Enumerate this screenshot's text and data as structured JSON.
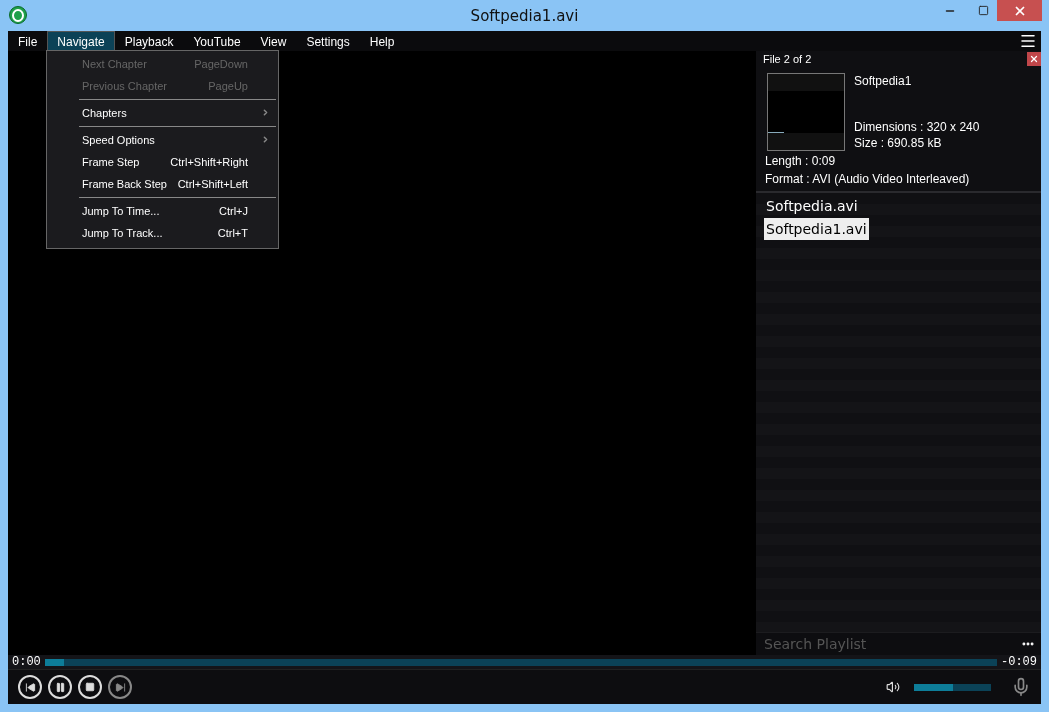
{
  "window": {
    "title": "Softpedia1.avi"
  },
  "menu_bar": [
    {
      "label": "File",
      "selected": false
    },
    {
      "label": "Navigate",
      "selected": true
    },
    {
      "label": "Playback",
      "selected": false
    },
    {
      "label": "YouTube",
      "selected": false
    },
    {
      "label": "View",
      "selected": false
    },
    {
      "label": "Settings",
      "selected": false
    },
    {
      "label": "Help",
      "selected": false
    }
  ],
  "navigate_menu": [
    {
      "kind": "item",
      "label": "Next Chapter",
      "shortcut": "PageDown",
      "disabled": true
    },
    {
      "kind": "item",
      "label": "Previous Chapter",
      "shortcut": "PageUp",
      "disabled": true
    },
    {
      "kind": "separator"
    },
    {
      "kind": "submenu",
      "label": "Chapters",
      "disabled": false
    },
    {
      "kind": "separator"
    },
    {
      "kind": "submenu",
      "label": "Speed Options",
      "disabled": false
    },
    {
      "kind": "item",
      "label": "Frame Step",
      "shortcut": "Ctrl+Shift+Right",
      "disabled": false
    },
    {
      "kind": "item",
      "label": "Frame Back Step",
      "shortcut": "Ctrl+Shift+Left",
      "disabled": false
    },
    {
      "kind": "separator"
    },
    {
      "kind": "item",
      "label": "Jump To Time...",
      "shortcut": "Ctrl+J",
      "disabled": false
    },
    {
      "kind": "item",
      "label": "Jump To Track...",
      "shortcut": "Ctrl+T",
      "disabled": false
    }
  ],
  "file_info": {
    "counter": "File 2 of 2",
    "name": "Softpedia1",
    "dimensions": "Dimensions : 320 x 240",
    "size": "Size : 690.85 kB",
    "length": "Length : 0:09",
    "format": "Format : AVI (Audio Video Interleaved)"
  },
  "playlist": [
    {
      "name": "Softpedia.avi",
      "selected": false
    },
    {
      "name": "Softpedia1.avi",
      "selected": true
    }
  ],
  "search": {
    "placeholder": "Search Playlist"
  },
  "seek": {
    "elapsed": "0:00",
    "remaining": "-0:09",
    "level": 0.02
  },
  "volume": {
    "level": 0.5
  }
}
